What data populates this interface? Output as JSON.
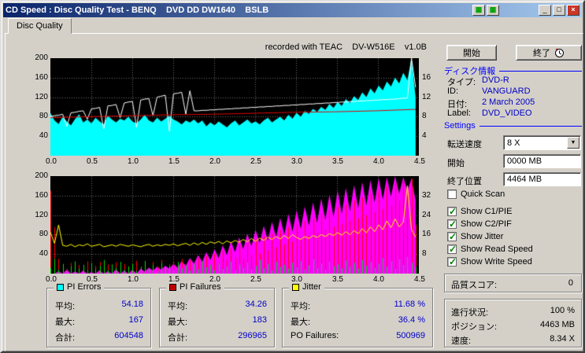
{
  "window": {
    "title": "CD Speed : Disc Quality Test - BENQ    DVD DD DW1640    BSLB"
  },
  "icons": {
    "graph": "▦",
    "minimize": "_",
    "maximize": "□",
    "close": "×",
    "dropdown": "▼"
  },
  "tab": {
    "label": "Disc Quality"
  },
  "recorded_note": "recorded with TEAC    DV-W516E    v1.0B",
  "actions": {
    "start": "開始",
    "exit": "終了"
  },
  "disc_info": {
    "title": "ディスク情報",
    "rows": [
      {
        "label": "タイプ:",
        "value": "DVD-R"
      },
      {
        "label": "ID:",
        "value": "VANGUARD"
      },
      {
        "label": "日付:",
        "value": "2 March 2005"
      },
      {
        "label": "Label:",
        "value": "DVD_VIDEO"
      }
    ]
  },
  "settings": {
    "title": "Settings",
    "speed": {
      "label": "転送速度",
      "value": "8 X"
    },
    "start": {
      "label": "開始",
      "value": "0000 MB"
    },
    "end": {
      "label": "終了位置",
      "value": "4464 MB"
    },
    "checkboxes": [
      {
        "label": "Quick Scan",
        "checked": false
      },
      {
        "label": "Show C1/PIE",
        "checked": true
      },
      {
        "label": "Show C2/PIF",
        "checked": true
      },
      {
        "label": "Show Jitter",
        "checked": true
      },
      {
        "label": "Show Read Speed",
        "checked": true
      },
      {
        "label": "Show Write Speed",
        "checked": true
      }
    ]
  },
  "quality": {
    "label": "品質スコア:",
    "value": "0"
  },
  "status": {
    "rows": [
      {
        "label": "進行状況:",
        "value": "100 %"
      },
      {
        "label": "ポジション:",
        "value": "4463 MB"
      },
      {
        "label": "速度:",
        "value": "8.34 X"
      }
    ]
  },
  "stats": {
    "boxes": [
      {
        "title": "PI Errors",
        "color": "#00ffff",
        "rows": [
          {
            "label": "平均:",
            "value": "54.18"
          },
          {
            "label": "最大:",
            "value": "167"
          },
          {
            "label": "合計:",
            "value": "604548"
          }
        ]
      },
      {
        "title": "PI Failures",
        "color": "#c00000",
        "rows": [
          {
            "label": "平均:",
            "value": "34.26"
          },
          {
            "label": "最大:",
            "value": "183"
          },
          {
            "label": "合計:",
            "value": "296965"
          }
        ]
      },
      {
        "title": "Jitter",
        "color": "#ffff00",
        "rows": [
          {
            "label": "平均:",
            "value": "11.68 %"
          },
          {
            "label": "最大:",
            "value": "36.4 %"
          },
          {
            "label": "PO Failures:",
            "value": "500969"
          }
        ]
      }
    ]
  },
  "chart_data": [
    {
      "type": "line",
      "note": "recorded with TEAC DV-W516E v1.0B",
      "xlim": [
        0,
        4.5
      ],
      "ylim": [
        0,
        200
      ],
      "x_end": 4.46,
      "xticks": [
        [
          0,
          "0.0"
        ],
        [
          0.5,
          "0.5"
        ],
        [
          1,
          "1.0"
        ],
        [
          1.5,
          "1.5"
        ],
        [
          2,
          "2.0"
        ],
        [
          2.5,
          "2.5"
        ],
        [
          3,
          "3.0"
        ],
        [
          3.5,
          "3.5"
        ],
        [
          4,
          "4.0"
        ],
        [
          4.5,
          "4.5"
        ]
      ],
      "yticks_left": [
        [
          200,
          "200"
        ],
        [
          160,
          "160"
        ],
        [
          120,
          "120"
        ],
        [
          80,
          "80"
        ],
        [
          40,
          "40"
        ]
      ],
      "yticks_right": [
        [
          160,
          "16"
        ],
        [
          120,
          "12"
        ],
        [
          80,
          "8"
        ],
        [
          40,
          "4"
        ]
      ],
      "series": [
        {
          "name": "PI Errors (C1/PIE)",
          "style": "area",
          "color": "#00ffff",
          "values": [
            88,
            72,
            65,
            80,
            70,
            62,
            75,
            85,
            68,
            74,
            66,
            78,
            70,
            64,
            82,
            74,
            68,
            76,
            72,
            80,
            70,
            66,
            74,
            84,
            72,
            68,
            78,
            70,
            76,
            82,
            74,
            70,
            64,
            72,
            68,
            74,
            66,
            72,
            60,
            68,
            62,
            70,
            64,
            58,
            66,
            72,
            62,
            68,
            74,
            66,
            70,
            64,
            72,
            78,
            68,
            74,
            80,
            72,
            84,
            76,
            88,
            80,
            92,
            86,
            96,
            90,
            100,
            94,
            106,
            98,
            110,
            102,
            116,
            108,
            122,
            114,
            130,
            120,
            138,
            128,
            144,
            134,
            152,
            142,
            160,
            148,
            170,
            155,
            200,
            120
          ]
        },
        {
          "name": "Read Speed",
          "style": "line",
          "color": "#ffffff",
          "values": [
            80,
            82,
            83,
            85,
            60,
            88,
            89,
            91,
            92,
            75,
            96,
            97,
            99,
            55,
            102,
            103,
            105,
            78,
            108,
            110,
            111,
            58,
            114,
            116,
            117,
            82,
            120,
            122,
            124,
            50,
            127,
            128,
            130,
            85,
            133,
            92,
            92,
            93,
            93,
            94,
            94,
            95,
            95,
            96,
            96,
            97,
            97,
            98,
            98,
            99,
            99,
            100,
            100,
            101,
            101,
            102,
            102,
            103,
            103,
            104,
            104,
            105,
            105,
            106,
            106,
            107,
            107,
            108,
            108,
            109,
            109,
            110,
            110,
            111,
            111,
            112,
            112,
            113,
            113,
            114,
            114,
            115,
            115,
            116,
            116,
            117,
            118,
            118,
            200,
            140
          ]
        },
        {
          "name": "Write Speed",
          "style": "line",
          "color": "#e00000",
          "values": [
            78,
            80,
            82,
            84,
            85,
            87,
            89,
            90,
            92,
            95
          ]
        }
      ]
    },
    {
      "type": "line",
      "xlim": [
        0,
        4.5
      ],
      "ylim": [
        0,
        200
      ],
      "x_end": 4.46,
      "xticks": [
        [
          0,
          "0.0"
        ],
        [
          0.5,
          "0.5"
        ],
        [
          1,
          "1.0"
        ],
        [
          1.5,
          "1.5"
        ],
        [
          2,
          "2.0"
        ],
        [
          2.5,
          "2.5"
        ],
        [
          3,
          "3.0"
        ],
        [
          3.5,
          "3.5"
        ],
        [
          4,
          "4.0"
        ],
        [
          4.5,
          "4.5"
        ]
      ],
      "yticks_left": [
        [
          200,
          "200"
        ],
        [
          160,
          "160"
        ],
        [
          120,
          "120"
        ],
        [
          80,
          "80"
        ],
        [
          40,
          "40"
        ]
      ],
      "yticks_right": [
        [
          160,
          "32"
        ],
        [
          120,
          "24"
        ],
        [
          80,
          "16"
        ],
        [
          40,
          "8"
        ]
      ],
      "series": [
        {
          "name": "PO Failures",
          "style": "area",
          "color": "#ff00ff",
          "values": [
            0,
            0,
            5,
            0,
            8,
            0,
            4,
            0,
            6,
            0,
            3,
            0,
            7,
            0,
            5,
            0,
            9,
            0,
            6,
            0,
            8,
            0,
            10,
            4,
            12,
            6,
            14,
            8,
            16,
            10,
            20,
            12,
            26,
            16,
            32,
            20,
            38,
            24,
            44,
            28,
            50,
            32,
            58,
            38,
            66,
            44,
            74,
            50,
            82,
            56,
            90,
            62,
            98,
            68,
            106,
            74,
            114,
            80,
            122,
            86,
            130,
            92,
            138,
            98,
            146,
            104,
            154,
            110,
            162,
            116,
            170,
            122,
            176,
            128,
            182,
            134,
            188,
            140,
            192,
            146,
            196,
            152,
            198,
            158,
            200,
            164,
            198,
            170,
            195,
            150
          ]
        },
        {
          "name": "PI Failures (C2/PIF)",
          "style": "spikes",
          "color": "#ff0000",
          "values": [
            170,
            95,
            30,
            15,
            10,
            22,
            8,
            18,
            12,
            25,
            9,
            16,
            24,
            11,
            19,
            7,
            23,
            14,
            20,
            10,
            17,
            26,
            12,
            21,
            9,
            24,
            15,
            28,
            11,
            19,
            25,
            13,
            30,
            18,
            27,
            14,
            32,
            20,
            36,
            16,
            40,
            22,
            46,
            28,
            52,
            34,
            58,
            30,
            64,
            38,
            70,
            42,
            76,
            48,
            82,
            54,
            88,
            60,
            95,
            66,
            100,
            72,
            108,
            78,
            115,
            84,
            122,
            90,
            130,
            96,
            136,
            102,
            142,
            108,
            150,
            114,
            156,
            120,
            164,
            126,
            170,
            132,
            178,
            140,
            185,
            150,
            190,
            160,
            195,
            100
          ]
        },
        {
          "name": "unlabeled (green)",
          "style": "spikes",
          "color": "#00d800",
          "values": [
            12,
            30,
            8,
            20,
            5,
            15,
            25,
            10,
            18,
            6,
            22,
            9,
            16,
            28,
            7,
            19,
            12,
            24,
            8,
            15,
            20,
            6,
            14,
            26,
            10,
            18,
            5,
            22,
            12,
            16,
            8,
            24,
            11,
            17,
            6,
            20,
            9,
            26,
            13,
            18,
            7,
            21,
            10,
            15,
            25,
            8,
            19,
            12,
            23,
            9,
            16,
            28,
            11,
            20,
            7,
            24,
            14,
            18,
            10,
            22,
            13,
            26,
            9,
            17,
            30,
            12,
            21,
            8,
            25,
            15,
            19,
            11,
            27,
            14,
            22,
            10,
            28,
            16,
            24,
            12,
            20,
            32,
            15,
            26,
            10,
            30,
            18,
            35,
            22,
            14
          ]
        },
        {
          "name": "Jitter",
          "style": "line",
          "color": "#ffff00",
          "values": [
            85,
            62,
            100,
            58,
            56,
            60,
            55,
            59,
            57,
            61,
            56,
            58,
            60,
            55,
            57,
            59,
            56,
            60,
            58,
            56,
            59,
            57,
            55,
            58,
            60,
            56,
            59,
            57,
            60,
            58,
            61,
            57,
            60,
            62,
            58,
            63,
            59,
            64,
            60,
            65,
            62,
            66,
            61,
            67,
            63,
            68,
            64,
            70,
            65,
            72,
            66,
            73,
            68,
            75,
            70,
            76,
            71,
            78,
            72,
            80,
            74,
            70,
            76,
            72,
            78,
            74,
            80,
            76,
            82,
            78,
            84,
            79,
            86,
            80,
            88,
            82,
            92,
            84,
            96,
            86,
            100,
            90,
            108,
            94,
            112,
            96,
            105,
            180,
            90,
            75
          ]
        }
      ]
    }
  ]
}
